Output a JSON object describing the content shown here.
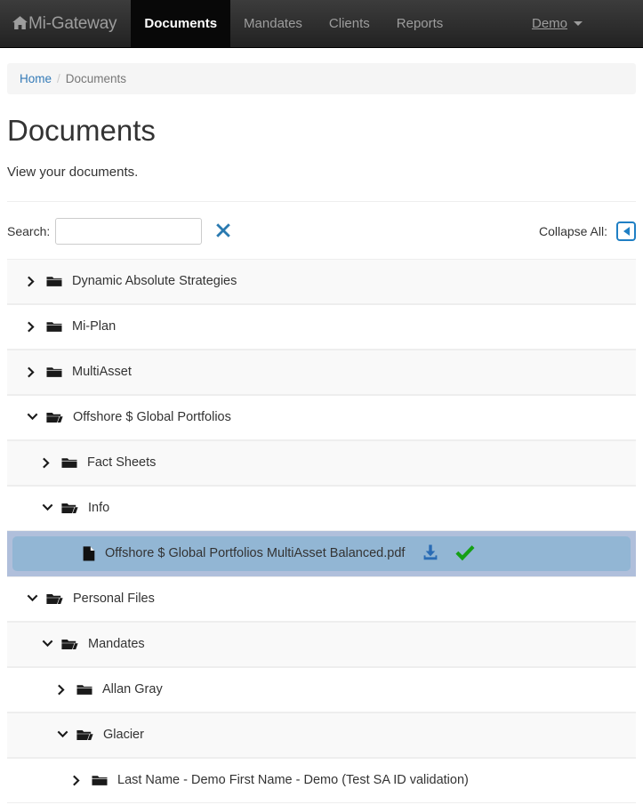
{
  "navbar": {
    "brand": "Mi-Gateway",
    "brand_icon": "home-icon",
    "items": [
      {
        "label": "Documents",
        "active": true
      },
      {
        "label": "Mandates",
        "active": false
      },
      {
        "label": "Clients",
        "active": false
      },
      {
        "label": "Reports",
        "active": false
      }
    ],
    "user": "Demo",
    "user_caret_icon": "caret-down-icon"
  },
  "breadcrumb": {
    "home": "Home",
    "separator": "/",
    "current": "Documents"
  },
  "page": {
    "title": "Documents",
    "subtitle": "View your documents."
  },
  "toolbar": {
    "search_label": "Search:",
    "search_value": "",
    "search_placeholder": "",
    "clear_icon": "close-x-icon",
    "collapse_label": "Collapse All:",
    "collapse_icon": "triangle-left-icon"
  },
  "colors": {
    "navbar_top": "#3c3c3c",
    "navbar_bottom": "#222222",
    "link": "#337ab7",
    "accent_blue": "#1f7fc4",
    "selected_outer": "#b0bfdb",
    "selected_inner": "#92b6d4",
    "download_icon": "#2a6cb5",
    "check_icon": "#15a015",
    "stripe": "#f9f9f9"
  },
  "tree": {
    "rows": [
      {
        "label": "Dynamic Absolute Strategies",
        "level": 0,
        "type": "folder",
        "expanded": false,
        "striped": true,
        "selected": false
      },
      {
        "label": "Mi-Plan",
        "level": 0,
        "type": "folder",
        "expanded": false,
        "striped": false,
        "selected": false
      },
      {
        "label": "MultiAsset",
        "level": 0,
        "type": "folder",
        "expanded": false,
        "striped": true,
        "selected": false
      },
      {
        "label": "Offshore $ Global Portfolios",
        "level": 0,
        "type": "folder",
        "expanded": true,
        "striped": false,
        "selected": false
      },
      {
        "label": "Fact Sheets",
        "level": 1,
        "type": "folder",
        "expanded": false,
        "striped": true,
        "selected": false
      },
      {
        "label": "Info",
        "level": 1,
        "type": "folder",
        "expanded": true,
        "striped": false,
        "selected": false
      },
      {
        "label": "Offshore $ Global Portfolios MultiAsset Balanced.pdf",
        "level": 3,
        "type": "file",
        "expanded": false,
        "striped": false,
        "selected": true,
        "actions": [
          "download-icon",
          "check-icon"
        ]
      },
      {
        "label": "Personal Files",
        "level": 0,
        "type": "folder",
        "expanded": true,
        "striped": false,
        "selected": false
      },
      {
        "label": "Mandates",
        "level": 1,
        "type": "folder",
        "expanded": true,
        "striped": true,
        "selected": false
      },
      {
        "label": "Allan Gray",
        "level": 2,
        "type": "folder",
        "expanded": false,
        "striped": false,
        "selected": false
      },
      {
        "label": "Glacier",
        "level": 2,
        "type": "folder",
        "expanded": true,
        "striped": true,
        "selected": false
      },
      {
        "label": "Last Name - Demo First Name - Demo (Test SA ID validation)",
        "level": 3,
        "type": "folder",
        "expanded": false,
        "striped": false,
        "selected": false
      }
    ]
  }
}
